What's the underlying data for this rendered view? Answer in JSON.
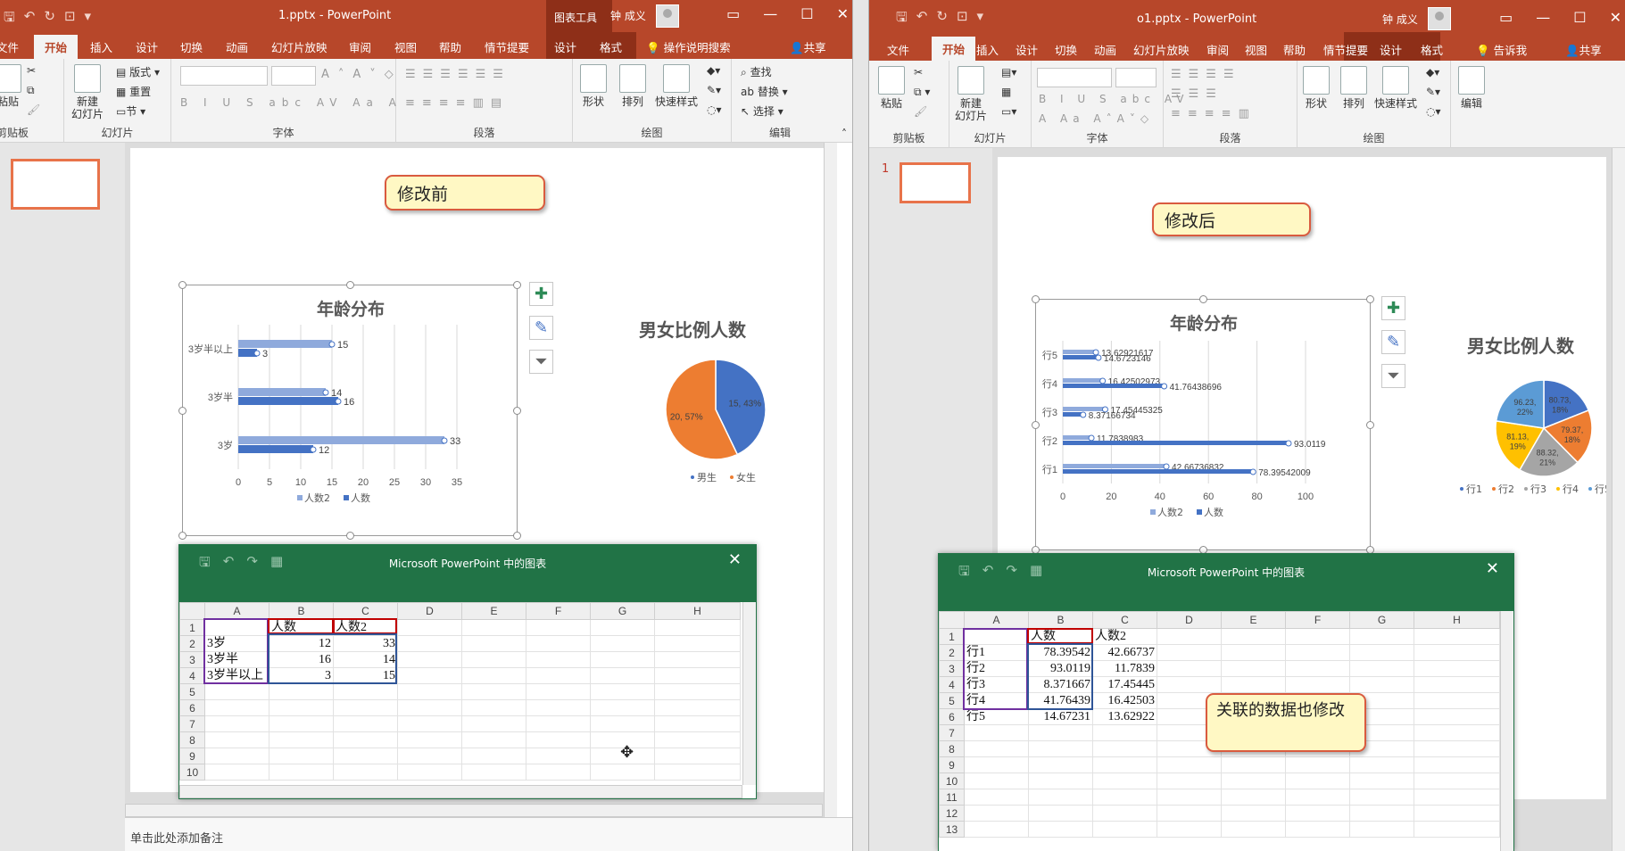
{
  "left": {
    "window_title": "1.pptx  -  PowerPoint",
    "context_tools": "图表工具",
    "user": "钟 成义",
    "tabs": [
      "文件",
      "开始",
      "插入",
      "设计",
      "切换",
      "动画",
      "幻灯片放映",
      "审阅",
      "视图",
      "帮助",
      "情节提要",
      "设计",
      "格式"
    ],
    "tell_me": "操作说明搜索",
    "share": "共享",
    "ribbon": {
      "paste": "粘贴",
      "clipboard": "剪贴板",
      "new_slide": "新建\n幻灯片",
      "layout": "版式",
      "reset": "重置",
      "section": "节",
      "slides_group": "幻灯片",
      "font_group": "字体",
      "paragraph_group": "段落",
      "shape": "形状",
      "arrange": "排列",
      "quick_styles": "快速样式",
      "drawing_group": "绘图",
      "find": "查找",
      "replace": "替换",
      "select": "选择",
      "editing_group": "编辑"
    },
    "callout": "修改前",
    "chart": {
      "title": "年龄分布",
      "legend": [
        "人数2",
        "人数"
      ],
      "side_buttons": [
        "chart-elements",
        "chart-styles",
        "chart-filters"
      ]
    },
    "pie": {
      "title": "男女比例人数",
      "labels": [
        "15, 43%",
        "20, 57%"
      ],
      "legend": [
        "男生",
        "女生"
      ]
    },
    "notes": "单击此处添加备注",
    "excel": {
      "title": "Microsoft PowerPoint 中的图表",
      "columns": [
        "A",
        "B",
        "C",
        "D",
        "E",
        "F",
        "G",
        "H"
      ],
      "rows": [
        [
          "",
          "人数",
          "人数2",
          "",
          "",
          "",
          "",
          ""
        ],
        [
          "3岁",
          "12",
          "33",
          "",
          "",
          "",
          "",
          ""
        ],
        [
          "3岁半",
          "16",
          "14",
          "",
          "",
          "",
          "",
          ""
        ],
        [
          "3岁半以上",
          "3",
          "15",
          "",
          "",
          "",
          "",
          ""
        ],
        [
          "",
          "",
          "",
          "",
          "",
          "",
          "",
          ""
        ],
        [
          "",
          "",
          "",
          "",
          "",
          "",
          "",
          ""
        ],
        [
          "",
          "",
          "",
          "",
          "",
          "",
          "",
          ""
        ],
        [
          "",
          "",
          "",
          "",
          "",
          "",
          "",
          ""
        ],
        [
          "",
          "",
          "",
          "",
          "",
          "",
          "",
          ""
        ],
        [
          "",
          "",
          "",
          "",
          "",
          "",
          "",
          ""
        ]
      ],
      "row_numbers": [
        "1",
        "2",
        "3",
        "4",
        "5",
        "6",
        "7",
        "8",
        "9",
        "10"
      ]
    }
  },
  "right": {
    "window_title": "o1.pptx  -  PowerPoint",
    "user": "钟 成义",
    "tabs": [
      "文件",
      "开始",
      "插入",
      "设计",
      "切换",
      "动画",
      "幻灯片放映",
      "审阅",
      "视图",
      "帮助",
      "情节提要",
      "设计",
      "格式"
    ],
    "tell_me": "告诉我",
    "share": "共享",
    "ribbon": {
      "paste": "粘贴",
      "clipboard": "剪贴板",
      "new_slide": "新建\n幻灯片",
      "slides_group": "幻灯片",
      "font_group": "字体",
      "paragraph_group": "段落",
      "shape": "形状",
      "arrange": "排列",
      "quick_styles": "快速样式",
      "drawing_group": "绘图",
      "edit": "编辑"
    },
    "slide_number": "1",
    "callout": "修改后",
    "callout2": "关联的数据也修改",
    "chart": {
      "title": "年龄分布",
      "legend": [
        "人数2",
        "人数"
      ],
      "side_buttons": [
        "chart-elements",
        "chart-styles",
        "chart-filters"
      ]
    },
    "pie": {
      "title": "男女比例人数",
      "labels": [
        "80.73,\n18%",
        "79.37,\n18%",
        "88.32,\n21%",
        "81.13,\n19%",
        "96.23,\n22%"
      ],
      "legend": [
        "行1",
        "行2",
        "行3",
        "行4",
        "行5"
      ]
    },
    "excel": {
      "title": "Microsoft PowerPoint 中的图表",
      "columns": [
        "A",
        "B",
        "C",
        "D",
        "E",
        "F",
        "G",
        "H"
      ],
      "rows": [
        [
          "",
          "人数",
          "人数2",
          "",
          "",
          "",
          "",
          ""
        ],
        [
          "行1",
          "78.39542",
          "42.66737",
          "",
          "",
          "",
          "",
          ""
        ],
        [
          "行2",
          "93.0119",
          "11.7839",
          "",
          "",
          "",
          "",
          ""
        ],
        [
          "行3",
          "8.371667",
          "17.45445",
          "",
          "",
          "",
          "",
          ""
        ],
        [
          "行4",
          "41.76439",
          "16.42503",
          "",
          "",
          "",
          "",
          ""
        ],
        [
          "行5",
          "14.67231",
          "13.62922",
          "",
          "",
          "",
          "",
          ""
        ],
        [
          "",
          "",
          "",
          "",
          "",
          "",
          "",
          ""
        ],
        [
          "",
          "",
          "",
          "",
          "",
          "",
          "",
          ""
        ],
        [
          "",
          "",
          "",
          "",
          "",
          "",
          "",
          ""
        ],
        [
          "",
          "",
          "",
          "",
          "",
          "",
          "",
          ""
        ],
        [
          "",
          "",
          "",
          "",
          "",
          "",
          "",
          ""
        ],
        [
          "",
          "",
          "",
          "",
          "",
          "",
          "",
          ""
        ],
        [
          "",
          "",
          "",
          "",
          "",
          "",
          "",
          ""
        ]
      ],
      "row_numbers": [
        "1",
        "2",
        "3",
        "4",
        "5",
        "6",
        "7",
        "8",
        "9",
        "10",
        "11",
        "12",
        "13"
      ]
    }
  },
  "colors": {
    "ppt_red": "#b7472a",
    "bar_dark": "#4472c4",
    "bar_light": "#8faadc",
    "pie_orange": "#ed7d31",
    "pie_blue": "#4472c4",
    "pie_gray": "#a5a5a5",
    "pie_gold": "#ffc000",
    "pie_lightblue": "#5b9bd5",
    "excel_green": "#217346",
    "callout_fill": "#fff8c4"
  },
  "chart_data": [
    {
      "type": "bar",
      "orientation": "horizontal",
      "title": "年龄分布",
      "categories": [
        "3岁",
        "3岁半",
        "3岁半以上"
      ],
      "series": [
        {
          "name": "人数2",
          "values": [
            33,
            14,
            15
          ]
        },
        {
          "name": "人数",
          "values": [
            12,
            16,
            3
          ]
        }
      ],
      "xlim": [
        0,
        35
      ],
      "xticks": [
        0,
        5,
        10,
        15,
        20,
        25,
        30,
        35
      ],
      "legend_position": "bottom",
      "grid": true
    },
    {
      "type": "pie",
      "title": "男女比例人数",
      "categories": [
        "男生",
        "女生"
      ],
      "values": [
        15,
        20
      ],
      "percent_labels": [
        "43%",
        "57%"
      ],
      "legend_position": "bottom"
    },
    {
      "type": "bar",
      "orientation": "horizontal",
      "title": "年龄分布",
      "categories": [
        "行1",
        "行2",
        "行3",
        "行4",
        "行5"
      ],
      "series": [
        {
          "name": "人数2",
          "values": [
            42.66736832,
            11.7838983,
            17.45445325,
            16.42502973,
            13.62921617
          ]
        },
        {
          "name": "人数",
          "values": [
            78.39542009,
            93.0119,
            8.37166734,
            41.76438696,
            14.6723146
          ]
        }
      ],
      "data_labels": {
        "人数2": [
          "42.66736832",
          "11.7838983",
          "17.45445325",
          "16.42502973",
          "13.62921617"
        ],
        "人数": [
          "78.39542009",
          "93.0119",
          "8.37166734",
          "41.76438696",
          "14.6723146"
        ]
      },
      "xlim": [
        0,
        100
      ],
      "xticks": [
        0,
        20,
        40,
        60,
        80,
        100
      ],
      "legend_position": "bottom",
      "grid": true
    },
    {
      "type": "pie",
      "title": "男女比例人数",
      "categories": [
        "行1",
        "行2",
        "行3",
        "行4",
        "行5"
      ],
      "values": [
        80.73,
        79.37,
        88.32,
        81.13,
        96.23
      ],
      "percent_labels": [
        "18%",
        "18%",
        "21%",
        "19%",
        "22%"
      ],
      "legend_position": "bottom"
    }
  ]
}
